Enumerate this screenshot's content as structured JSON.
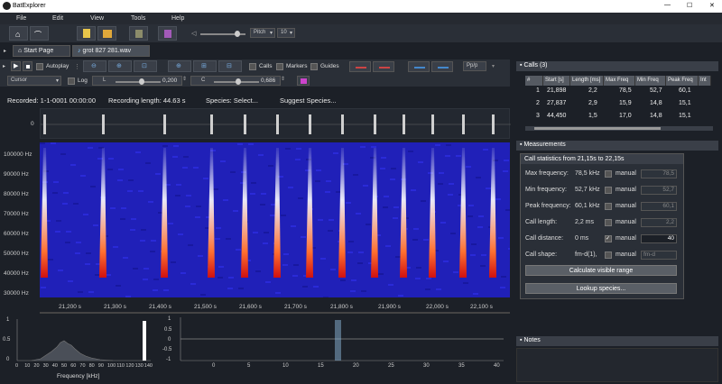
{
  "window": {
    "title": "BatExplorer",
    "min": "—",
    "max": "☐",
    "close": "✕"
  },
  "menu": [
    "File",
    "Edit",
    "View",
    "Tools",
    "Help"
  ],
  "toolbar": {
    "pitch_label": "Pitch",
    "pitch_value": "10"
  },
  "tabs": [
    {
      "label": "Start Page"
    },
    {
      "label": "grot 827 281.wav"
    }
  ],
  "controls": {
    "autoplay": "Autoplay",
    "calls": "Calls",
    "markers": "Markers",
    "guides": "Guides",
    "pplp": "Pp/p",
    "cursor": "Cursor",
    "log": "Log",
    "l_label": "L",
    "l_value": "0,200",
    "c_label": "C",
    "c_value": "0,686"
  },
  "info": {
    "recorded": "Recorded: 1-1-0001 00:00:00",
    "length": "Recording length: 44.63 s",
    "species": "Species: Select...",
    "suggest": "Suggest Species..."
  },
  "wave_label": "0",
  "y_ticks": [
    "100000 Hz",
    "90000 Hz",
    "80000 Hz",
    "70000 Hz",
    "60000 Hz",
    "50000 Hz",
    "40000 Hz",
    "30000 Hz"
  ],
  "x_ticks": [
    "21,200 s",
    "21,300 s",
    "21,400 s",
    "21,500 s",
    "21,600 s",
    "21,700 s",
    "21,800 s",
    "21,900 s",
    "22,000 s",
    "22,100 s"
  ],
  "freq_panel": {
    "xlabel": "Frequency [kHz]",
    "xticks": [
      "0",
      "10",
      "20",
      "30",
      "40",
      "50",
      "60",
      "70",
      "80",
      "90",
      "100",
      "110",
      "120",
      "130",
      "140"
    ],
    "yticks": [
      "1",
      "0.5",
      "0"
    ]
  },
  "time_panel": {
    "xticks": [
      "0",
      "5",
      "10",
      "15",
      "20",
      "25",
      "30",
      "35",
      "40"
    ],
    "yticks": [
      "1",
      "0.5",
      "0",
      "-0.5",
      "-1"
    ]
  },
  "calls": {
    "title": "Calls (3)",
    "columns": [
      "#",
      "Start [s]",
      "Length [ms]",
      "Max Freq",
      "Min Freq",
      "Peak Freq",
      "Int"
    ],
    "rows": [
      [
        "1",
        "21,898",
        "2,2",
        "78,5",
        "52,7",
        "60,1"
      ],
      [
        "2",
        "27,837",
        "2,9",
        "15,9",
        "14,8",
        "15,1"
      ],
      [
        "3",
        "44,450",
        "1,5",
        "17,0",
        "14,8",
        "15,1"
      ]
    ]
  },
  "measurements": {
    "title": "Measurements",
    "subtitle": "Call statistics from 21,15s to 22,15s",
    "rows": [
      {
        "label": "Max frequency:",
        "value": "78,5 kHz",
        "manual": "manual",
        "box": "78,5",
        "checked": false
      },
      {
        "label": "Min frequency:",
        "value": "52,7 kHz",
        "manual": "manual",
        "box": "52,7",
        "checked": false
      },
      {
        "label": "Peak frequency:",
        "value": "60,1 kHz",
        "manual": "manual",
        "box": "60,1",
        "checked": false
      },
      {
        "label": "Call length:",
        "value": "2,2 ms",
        "manual": "manual",
        "box": "2,2",
        "checked": false
      },
      {
        "label": "Call distance:",
        "value": "0 ms",
        "manual": "manual",
        "box": "40",
        "checked": true
      },
      {
        "label": "Call shape:",
        "value": "fm-d(1),",
        "manual": "manual",
        "box": "fm-d",
        "checked": false
      }
    ],
    "calc": "Calculate visible range",
    "lookup": "Lookup species..."
  },
  "notes": {
    "title": "Notes"
  }
}
